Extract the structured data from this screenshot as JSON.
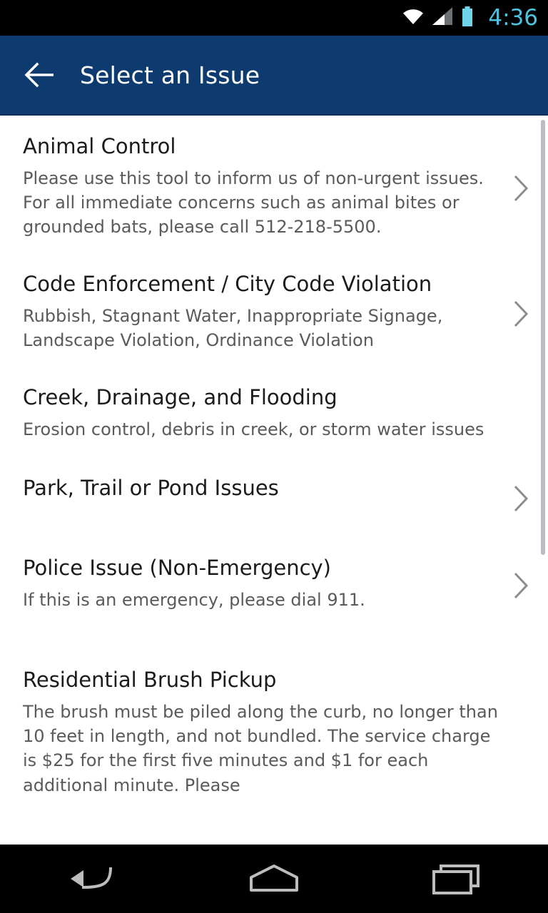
{
  "status_bar": {
    "time": "4:36",
    "icons": [
      "wifi-icon",
      "cell-signal-icon",
      "battery-icon"
    ],
    "accent_color": "#4ec3e0",
    "background": "#000000"
  },
  "app_bar": {
    "title": "Select an Issue",
    "back_icon": "back-arrow-icon",
    "background": "#0d3b70",
    "text_color": "#ffffff"
  },
  "list": {
    "items": [
      {
        "title": "Animal Control",
        "description": "Please use this tool to inform us of non-urgent issues. For all immediate concerns such as animal bites or grounded bats, please call 512-218-5500.",
        "has_chevron": true
      },
      {
        "title": "Code Enforcement / City Code Violation",
        "description": "Rubbish, Stagnant Water, Inappropriate Signage, Landscape Violation, Ordinance Violation",
        "has_chevron": true
      },
      {
        "title": "Creek, Drainage, and Flooding",
        "description": "Erosion control, debris in creek, or storm water issues",
        "has_chevron": false
      },
      {
        "title": "Park, Trail or Pond Issues",
        "description": "",
        "has_chevron": true
      },
      {
        "title": "Police Issue (Non-Emergency)",
        "description": "If this is an emergency, please dial 911.",
        "has_chevron": true
      },
      {
        "title": "Residential Brush Pickup",
        "description": "The brush must be piled along the curb, no longer than 10 feet in length, and not bundled.  The service charge is $25 for the first five minutes and $1 for each additional minute.  Please",
        "has_chevron": false
      }
    ]
  },
  "nav_bar": {
    "buttons": [
      "back-nav-icon",
      "home-nav-icon",
      "recents-nav-icon"
    ],
    "background": "#000000"
  }
}
